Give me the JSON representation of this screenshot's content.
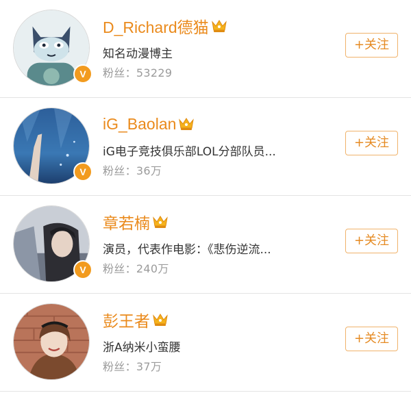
{
  "colors": {
    "name": "#ea8a1c",
    "verified_badge": "#f29b1f",
    "follow_border": "#f0b26a",
    "follow_text": "#e58a22",
    "fans_text": "#9b9b9b"
  },
  "users": [
    {
      "name": "D_Richard德猫",
      "desc": "知名动漫博主",
      "fans": "粉丝：53229",
      "verified": "V",
      "crown_icon": "vip-crown-icon",
      "follow_label": "+关注"
    },
    {
      "name": "iG_Baolan",
      "desc": "iG电子竞技俱乐部LOL分部队员...",
      "fans": "粉丝：36万",
      "verified": "V",
      "crown_icon": "vip-crown-icon",
      "follow_label": "+关注"
    },
    {
      "name": "章若楠",
      "desc": "演员，代表作电影：《悲伤逆流...",
      "fans": "粉丝：240万",
      "verified": "V",
      "crown_icon": "vip-crown-icon",
      "follow_label": "+关注"
    },
    {
      "name": "彭王者",
      "desc": "浙A纳米小蛮腰",
      "fans": "粉丝：37万",
      "crown_icon": "vip-crown-icon",
      "follow_label": "+关注"
    }
  ]
}
